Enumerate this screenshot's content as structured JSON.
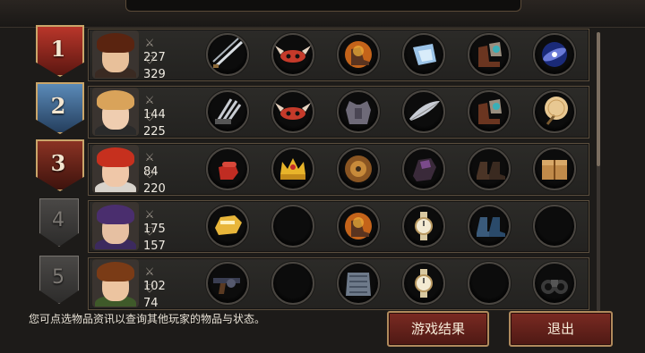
{
  "players": [
    {
      "rank": "1",
      "attack": "227",
      "defense": "329",
      "rank_style": "gold",
      "items": [
        "twin-swords-icon",
        "winged-mask-icon",
        "flaming-boot-icon",
        "crystal-shard-icon",
        "spiked-boots-icon",
        "galaxy-orb-icon"
      ]
    },
    {
      "rank": "2",
      "attack": "144",
      "defense": "225",
      "rank_style": "silver",
      "items": [
        "claw-blades-icon",
        "winged-mask-icon",
        "armor-vest-icon",
        "feather-blade-icon",
        "spiked-boots-icon",
        "golden-fan-icon"
      ]
    },
    {
      "rank": "3",
      "attack": "84",
      "defense": "220",
      "rank_style": "bronze",
      "items": [
        "red-fist-icon",
        "crown-icon",
        "round-shield-icon",
        "dark-gauntlet-icon",
        "leather-boots-icon",
        "wooden-crate-icon"
      ]
    },
    {
      "rank": "4",
      "attack": "175",
      "defense": "157",
      "rank_style": "plain",
      "items": [
        "golden-gauntlet-icon",
        "",
        "flaming-boot-icon",
        "wristwatch-icon",
        "blue-boots-icon",
        ""
      ]
    },
    {
      "rank": "5",
      "attack": "102",
      "defense": "74",
      "rank_style": "plain",
      "items": [
        "revolver-icon",
        "",
        "chainmail-icon",
        "wristwatch-icon",
        "",
        "binoculars-icon"
      ]
    }
  ],
  "footer": {
    "tip": "您可点选物品资讯以查询其他玩家的物品与状态。",
    "results_button": "游戏结果",
    "exit_button": "退出"
  }
}
